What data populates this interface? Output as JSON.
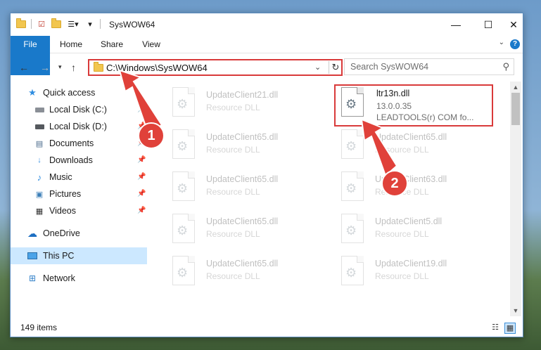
{
  "window": {
    "title": "SysWOW64"
  },
  "title_controls": {
    "minimize": "—",
    "maximize": "☐",
    "close": "✕"
  },
  "ribbon": {
    "tabs": [
      "File",
      "Home",
      "Share",
      "View"
    ],
    "help": "?"
  },
  "address_bar": {
    "path": "C:\\Windows\\SysWOW64"
  },
  "search": {
    "placeholder": "Search SysWOW64"
  },
  "sidebar": {
    "items": [
      {
        "label": "Quick access",
        "icon": "star-icon",
        "pinned": false
      },
      {
        "label": "Local Disk (C:)",
        "icon": "drive-icon",
        "pinned": true
      },
      {
        "label": "Local Disk (D:)",
        "icon": "drive-icon",
        "pinned": true
      },
      {
        "label": "Documents",
        "icon": "document-icon",
        "pinned": true
      },
      {
        "label": "Downloads",
        "icon": "download-icon",
        "pinned": true
      },
      {
        "label": "Music",
        "icon": "music-icon",
        "pinned": true
      },
      {
        "label": "Pictures",
        "icon": "picture-icon",
        "pinned": true
      },
      {
        "label": "Videos",
        "icon": "video-icon",
        "pinned": true
      },
      {
        "label": "OneDrive",
        "icon": "cloud-icon",
        "pinned": false
      },
      {
        "label": "This PC",
        "icon": "computer-icon",
        "pinned": false,
        "selected": true
      },
      {
        "label": "Network",
        "icon": "network-icon",
        "pinned": false
      }
    ]
  },
  "files": [
    {
      "name": "UpdateClient21.dll",
      "type": "Resource DLL",
      "faded": true
    },
    {
      "name": "ltr13n.dll",
      "type": "13.0.0.35",
      "desc": "LEADTOOLS(r) COM fo...",
      "faded": false,
      "highlighted": true
    },
    {
      "name": "UpdateClient65.dll",
      "type": "Resource DLL",
      "faded": true
    },
    {
      "name": "UpdateClient65.dll",
      "type": "Resource DLL",
      "faded": true
    },
    {
      "name": "UpdateClient65.dll",
      "type": "Resource DLL",
      "faded": true
    },
    {
      "name": "UpdateClient63.dll",
      "type": "Resource DLL",
      "faded": true
    },
    {
      "name": "UpdateClient65.dll",
      "type": "Resource DLL",
      "faded": true
    },
    {
      "name": "UpdateClient5.dll",
      "type": "Resource DLL",
      "faded": true
    },
    {
      "name": "UpdateClient65.dll",
      "type": "Resource DLL",
      "faded": true
    },
    {
      "name": "UpdateClient19.dll",
      "type": "Resource DLL",
      "faded": true
    }
  ],
  "status": {
    "count": "149 items"
  },
  "callouts": {
    "one": "1",
    "two": "2"
  },
  "colors": {
    "accent": "#1979ca",
    "highlight": "#d93a3a",
    "selected": "#cce8ff"
  }
}
